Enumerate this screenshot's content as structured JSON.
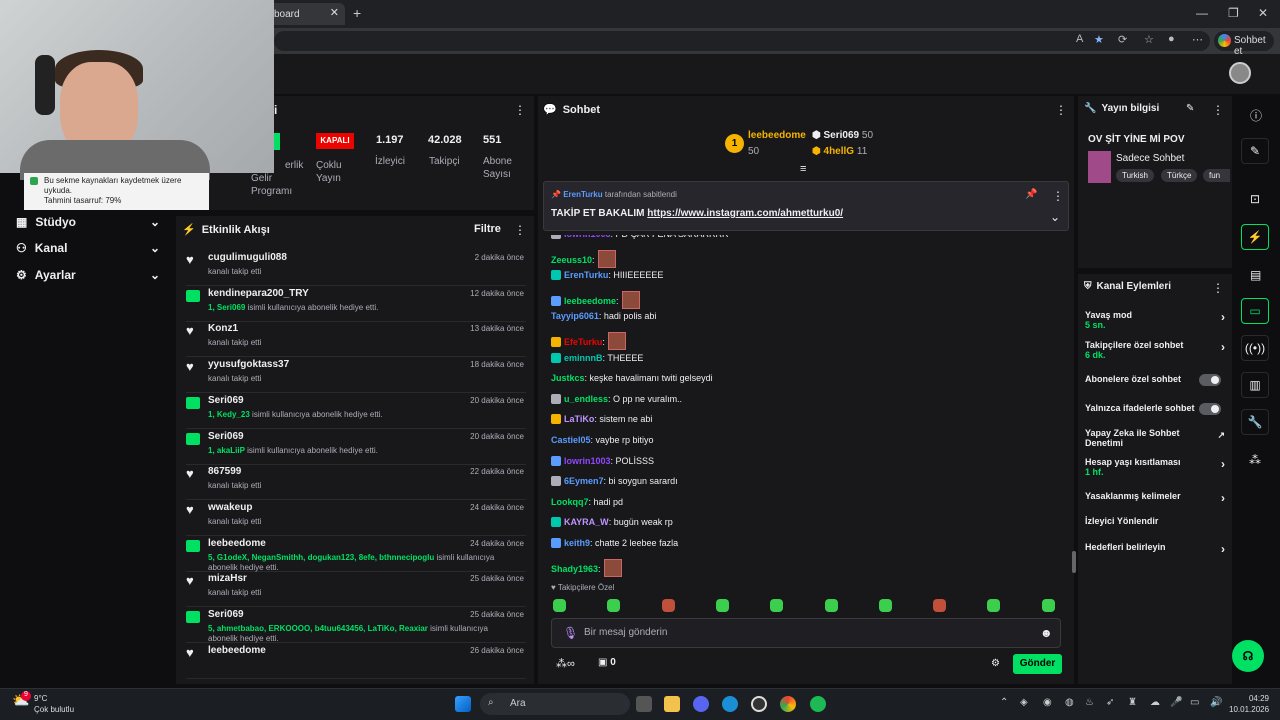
{
  "browser": {
    "tab_title": "board",
    "sohbet_et": "Sohbet et"
  },
  "toast": {
    "line1": "Bu sekme kaynakları kaydetmek üzere",
    "line2": "uykuda.",
    "line3": "Tahmini tasarruf: 79%"
  },
  "nav": [
    {
      "label": "Stüdyo"
    },
    {
      "label": "Kanal"
    },
    {
      "label": "Ayarlar"
    }
  ],
  "stats": {
    "header_fragment": "i",
    "kapali": "KAPALI",
    "gelir_l1": "erlik",
    "gelir_l2": "Gelir",
    "gelir_l3": "Programı",
    "coklu_l1": "Çoklu",
    "coklu_l2": "Yayın",
    "izleyici_num": "1.197",
    "izleyici_lbl": "İzleyici",
    "takipci_num": "42.028",
    "takipci_lbl": "Takipçi",
    "abone_num": "551",
    "abone_lbl1": "Abone",
    "abone_lbl2": "Sayısı"
  },
  "activity": {
    "title": "Etkinlik Akışı",
    "filter": "Filtre",
    "items": [
      {
        "type": "follow",
        "name": "cugulimuguli088",
        "sub": "kanalı takip etti",
        "time": "2 dakika önce"
      },
      {
        "type": "gift",
        "name": "kendinepara200_TRY",
        "sub_hl": "1, Seri069",
        "sub": "isimli kullanıcıya abonelik hediye etti.",
        "time": "12 dakika önce"
      },
      {
        "type": "follow",
        "name": "Konz1",
        "sub": "kanalı takip etti",
        "time": "13 dakika önce"
      },
      {
        "type": "follow",
        "name": "yyusufgoktass37",
        "sub": "kanalı takip etti",
        "time": "18 dakika önce"
      },
      {
        "type": "gift",
        "name": "Seri069",
        "sub_hl": "1, Kedy_23",
        "sub": "isimli kullanıcıya abonelik hediye etti.",
        "time": "20 dakika önce"
      },
      {
        "type": "gift",
        "name": "Seri069",
        "sub_hl": "1, akaLiiP",
        "sub": "isimli kullanıcıya abonelik hediye etti.",
        "time": "20 dakika önce"
      },
      {
        "type": "follow",
        "name": "867599",
        "sub": "kanalı takip etti",
        "time": "22 dakika önce"
      },
      {
        "type": "follow",
        "name": "wwakeup",
        "sub": "kanalı takip etti",
        "time": "24 dakika önce"
      },
      {
        "type": "gift",
        "name": "leebeedome",
        "sub_hl": "5, G1odeX, NeganSmithh, dogukan123, 8efe, bthnnecipoglu",
        "sub": "isimli kullanıcıya abonelik hediye etti.",
        "time": "24 dakika önce"
      },
      {
        "type": "follow",
        "name": "mizaHsr",
        "sub": "kanalı takip etti",
        "time": "25 dakika önce"
      },
      {
        "type": "gift",
        "name": "Seri069",
        "sub_hl": "5, ahmetbabao, ERKOOOO, b4tuu643456, LaTiKo, Reaxiar",
        "sub": "isimli kullanıcıya abonelik hediye etti.",
        "time": "25 dakika önce"
      },
      {
        "type": "follow",
        "name": "leebeedome",
        "sub": "",
        "time": "26 dakika önce"
      }
    ]
  },
  "chat": {
    "title": "Sohbet",
    "leader1_rank": "1",
    "leader1_name": "leebeedome",
    "leader1_count": "50",
    "leader2_name": "Seri069",
    "leader2_count": "50",
    "leader3_name": "4hellG",
    "leader3_count": "11",
    "pinned_by": "ErenTurku",
    "pinned_suffix": "tarafından sabitlendi",
    "pinned_text": "TAKİP ET BAKALIM",
    "pinned_link": "https://www.instagram.com/ahmetturku0/",
    "messages": [
      {
        "user": "lowrin1003",
        "color": "#9147ff",
        "text": ": PD ÇAR FENA SARARRRR"
      },
      {
        "user": "Zeeuss10",
        "color": "#00e164",
        "text": ":",
        "emote": true
      },
      {
        "user": "ErenTurku",
        "color": "#5b9cff",
        "text": ": HIIIEEEEEE"
      },
      {
        "user": "leebeedome",
        "color": "#00e164",
        "text": ":",
        "emote": true
      },
      {
        "user": "Tayyip6061",
        "color": "#5b9cff",
        "text": ": hadi polis abi"
      },
      {
        "user": "EfeTurku",
        "color": "#eb0400",
        "text": ":",
        "emote": true
      },
      {
        "user": "eminnnB",
        "color": "#00c8af",
        "text": ": THEEEE"
      },
      {
        "user": "Justkcs",
        "color": "#00e164",
        "text": ": keşke havalimanı twiti gelseydi"
      },
      {
        "user": "u_endless",
        "color": "#00e164",
        "text": ": O pp ne vuralım.."
      },
      {
        "user": "LaTiKo",
        "color": "#bf94ff",
        "text": ": sistem ne abi"
      },
      {
        "user": "Castiel05",
        "color": "#5b9cff",
        "text": ": vaybe rp bitiyo"
      },
      {
        "user": "lowrin1003",
        "color": "#9147ff",
        "text": ": POLİSSS"
      },
      {
        "user": "6Eymen7",
        "color": "#5b9cff",
        "text": ": bi soygun sarardı"
      },
      {
        "user": "Lookqq7",
        "color": "#00e164",
        "text": ": hadi pd"
      },
      {
        "user": "KAYRA_W",
        "color": "#bf94ff",
        "text": ": bugün weak rp"
      },
      {
        "user": "keith9",
        "color": "#5b9cff",
        "text": ": chatte 2 leebee fazla"
      },
      {
        "user": "Shady1963",
        "color": "#00e164",
        "text": ":",
        "emote": true
      }
    ],
    "followers_only": "Takipçilere Özel",
    "input_placeholder": "Bir mesaj gönderin",
    "points": "0",
    "send": "Gönder"
  },
  "stream_info": {
    "title": "Yayın bilgisi",
    "stream_title": "OV ŞİT YİNE Mİ POV",
    "category": "Sadece Sohbet",
    "tags": [
      "Turkish",
      "Türkçe",
      "fun"
    ]
  },
  "channel_actions": {
    "title": "Kanal Eylemleri",
    "rows": [
      {
        "label": "Yavaş mod",
        "value": "5 sn.",
        "kind": "arrow"
      },
      {
        "label": "Takipçilere özel sohbet",
        "value": "6 dk.",
        "kind": "arrow"
      },
      {
        "label": "Abonelere özel sohbet",
        "value": "",
        "kind": "toggle"
      },
      {
        "label": "Yalnızca ifadelerle sohbet",
        "value": "",
        "kind": "toggle"
      },
      {
        "label": "Yapay Zeka ile Sohbet Denetimi",
        "value": "",
        "kind": "external"
      },
      {
        "label": "Hesap yaşı kısıtlaması",
        "value": "1 hf.",
        "kind": "arrow"
      },
      {
        "label": "Yasaklanmış kelimeler",
        "value": "",
        "kind": "arrow"
      },
      {
        "label": "İzleyici Yönlendir",
        "value": "",
        "kind": "none"
      },
      {
        "label": "Hedefleri belirleyin",
        "value": "",
        "kind": "arrow"
      }
    ]
  },
  "taskbar": {
    "weather_temp": "9°C",
    "weather_desc": "Çok bulutlu",
    "search": "Ara",
    "time": "04:29",
    "date": "10.01.2026",
    "badge": "9"
  },
  "colors": {
    "accent": "#00e164",
    "live_off": "#eb0400"
  }
}
